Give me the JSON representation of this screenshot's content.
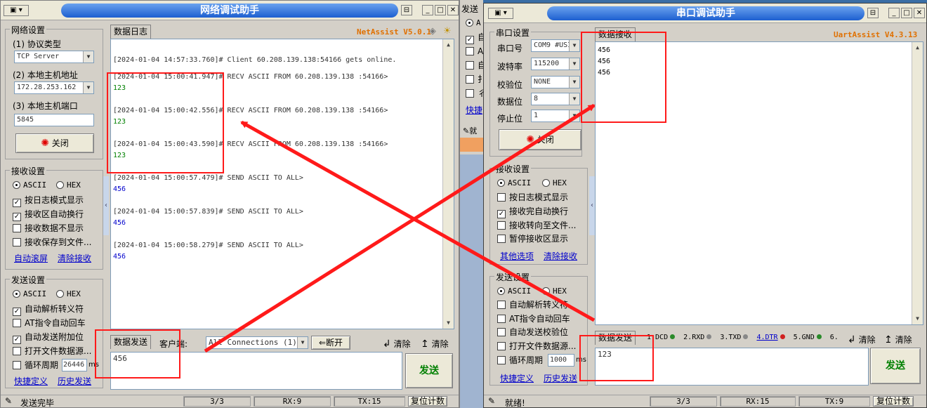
{
  "net": {
    "title": "网络调试助手",
    "brand": "NetAssist V5.0.1",
    "net_settings_title": "网络设置",
    "protocol_label": "(1) 协议类型",
    "protocol_value": "TCP Server",
    "host_label": "(2) 本地主机地址",
    "host_value": "172.28.253.162",
    "port_label": "(3) 本地主机端口",
    "port_value": "5845",
    "close_button": "关闭",
    "recv_settings_title": "接收设置",
    "ascii": "ASCII",
    "hex": "HEX",
    "recv_options": [
      "按日志模式显示",
      "接收区自动换行",
      "接收数据不显示",
      "接收保存到文件..."
    ],
    "recv_links": [
      "自动滚屏",
      "清除接收"
    ],
    "send_settings_title": "发送设置",
    "send_options": [
      "自动解析转义符",
      "AT指令自动回车",
      "自动发送附加位",
      "打开文件数据源...",
      "循环周期"
    ],
    "cycle_value": "26446",
    "cycle_unit": "ms",
    "send_links": [
      "快捷定义",
      "历史发送"
    ],
    "log_tab": "数据日志",
    "log": [
      {
        "header": "[2024-01-04 14:57:33.760]# Client 60.208.139.138:54166 gets online.",
        "data": ""
      },
      {
        "header": "[2024-01-04 15:00:41.947]# RECV ASCII FROM 60.208.139.138 :54166>",
        "data": "123"
      },
      {
        "header": "[2024-01-04 15:00:42.556]# RECV ASCII FROM 60.208.139.138 :54166>",
        "data": "123"
      },
      {
        "header": "[2024-01-04 15:00:43.590]# RECV ASCII FROM 60.208.139.138 :54166>",
        "data": "123"
      },
      {
        "header": "[2024-01-04 15:00:57.479]# SEND ASCII TO ALL>",
        "data": "456"
      },
      {
        "header": "[2024-01-04 15:00:57.839]# SEND ASCII TO ALL>",
        "data": "456"
      },
      {
        "header": "[2024-01-04 15:00:58.279]# SEND ASCII TO ALL>",
        "data": "456"
      }
    ],
    "send_tab": "数据发送",
    "client_label": "客户端:",
    "client_value": "All Connections (1)",
    "disconnect_button": "断开",
    "clear_label_1": "清除",
    "clear_label_2": "清除",
    "send_text": "456",
    "send_button": "发送",
    "status_text": "发送完毕",
    "status_count": "3/3",
    "status_rx": "RX:9",
    "status_tx": "TX:15",
    "reset_button": "复位计数"
  },
  "strip": {
    "label_top": "发送",
    "label_mid": "快捷",
    "label_status": "就",
    "radio": "A",
    "check_letters": [
      "自",
      "A",
      "自",
      "扌",
      "彳"
    ]
  },
  "uart": {
    "title": "串口调试助手",
    "brand": "UartAssist V4.3.13",
    "port_settings_title": "串口设置",
    "port_label": "串口号",
    "port_value": "COM9 #USI",
    "baud_label": "波特率",
    "baud_value": "115200",
    "parity_label": "校验位",
    "parity_value": "NONE",
    "databits_label": "数据位",
    "databits_value": "8",
    "stopbits_label": "停止位",
    "stopbits_value": "1",
    "close_button": "关闭",
    "recv_settings_title": "接收设置",
    "ascii": "ASCII",
    "hex": "HEX",
    "recv_options": [
      "按日志模式显示",
      "接收完自动换行",
      "接收转向至文件...",
      "暂停接收区显示"
    ],
    "recv_links": [
      "其他选项",
      "清除接收"
    ],
    "send_settings_title": "发送设置",
    "send_options": [
      "自动解析转义符",
      "AT指令自动回车",
      "自动发送校验位",
      "打开文件数据源...",
      "循环周期"
    ],
    "cycle_value": "1000",
    "cycle_unit": "ms",
    "send_links": [
      "快捷定义",
      "历史发送"
    ],
    "recv_tab": "数据接收",
    "recv_lines": [
      "456",
      "456",
      "456"
    ],
    "send_tab": "数据发送",
    "signals": [
      "1.DCD",
      "2.RXD",
      "3.TXD",
      "4.DTR",
      "5.GND",
      "6."
    ],
    "clear_label_1": "清除",
    "clear_label_2": "清除",
    "send_text": "123",
    "send_button": "发送",
    "status_text": "就绪!",
    "status_count": "3/3",
    "status_rx": "RX:15",
    "status_tx": "TX:9",
    "reset_button": "复位计数"
  },
  "colors": {
    "recv_data": "#008000",
    "send_data": "#0000cc",
    "highlight": "#ff1a1a",
    "brand": "#e07000"
  }
}
